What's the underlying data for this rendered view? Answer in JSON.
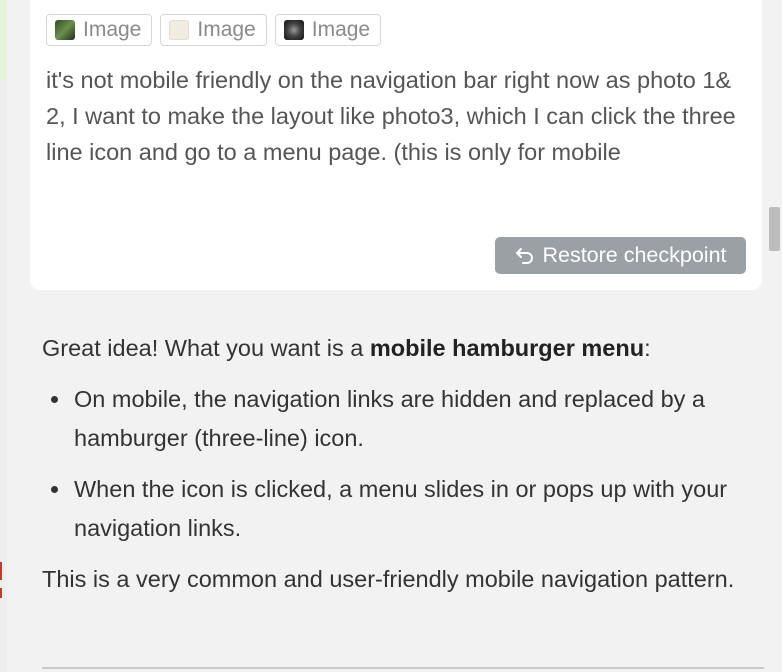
{
  "user_message": {
    "attachments": [
      {
        "label": "Image",
        "thumb": "green-photo-thumbnail"
      },
      {
        "label": "Image",
        "thumb": "beige-blank-thumbnail"
      },
      {
        "label": "Image",
        "thumb": "dark-photo-thumbnail"
      }
    ],
    "text": "it's not mobile friendly on the navigation bar right now as photo 1& 2, I want to make the layout like photo3, which I can click the three line icon and go to a menu page. (this is only for mobile",
    "restore_button": {
      "label": "Restore checkpoint",
      "icon": "undo-arrow-icon"
    }
  },
  "assistant_message": {
    "intro_prefix": "Great idea! What you want is a ",
    "intro_bold": "mobile hamburger menu",
    "intro_suffix": ":",
    "bullets": [
      "On mobile, the navigation links are hidden and replaced by a hamburger (three-line) icon.",
      "When the icon is clicked, a menu slides in or pops up with your navigation links."
    ],
    "closing": "This is a very common and user-friendly mobile navigation pattern."
  },
  "colors": {
    "background": "#f2f2f2",
    "card": "#ffffff",
    "restore_button": "#9aa0a6",
    "text": "#333333"
  }
}
